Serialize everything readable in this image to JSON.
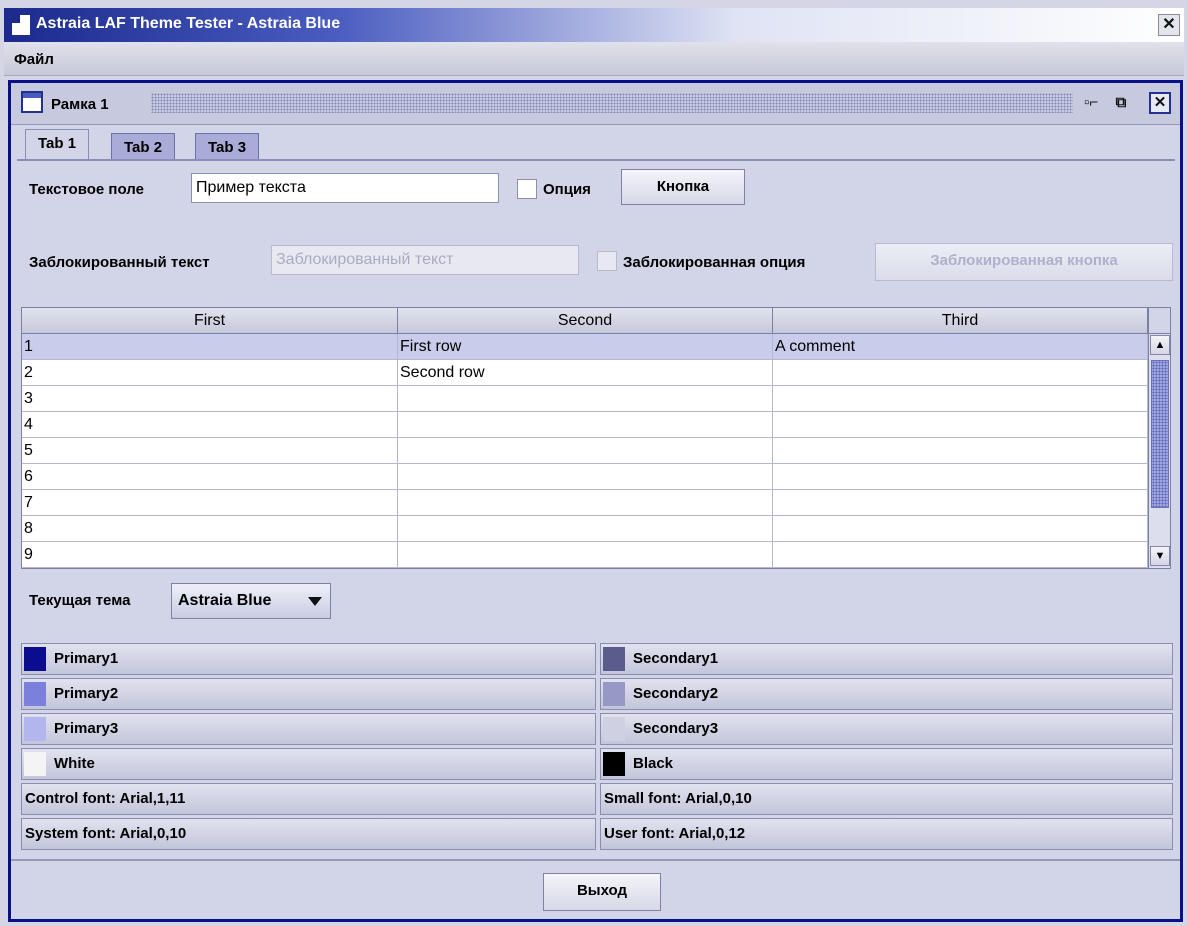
{
  "window": {
    "title": "Astraia LAF Theme Tester - Astraia Blue",
    "close_glyph": "✕"
  },
  "menu": {
    "file": "Файл"
  },
  "frame": {
    "title": "Рамка 1",
    "min_glyph": "▫⌐",
    "max_glyph": "⧉",
    "close_glyph": "✕"
  },
  "tabs": [
    {
      "label": "Tab 1"
    },
    {
      "label": "Tab 2"
    },
    {
      "label": "Tab 3"
    }
  ],
  "row1": {
    "text_label": "Текстовое поле",
    "text_value": "Пример текста",
    "check_label": "Опция",
    "button_label": "Кнопка"
  },
  "row2": {
    "text_label": "Заблокированный текст",
    "text_value": "Заблокированный текст",
    "check_label": "Заблокированная опция",
    "button_label": "Заблокированная кнопка"
  },
  "table": {
    "columns": [
      "First",
      "Second",
      "Third"
    ],
    "rows": [
      [
        "1",
        "First row",
        "A comment"
      ],
      [
        "2",
        "Second row",
        ""
      ],
      [
        "3",
        "",
        ""
      ],
      [
        "4",
        "",
        ""
      ],
      [
        "5",
        "",
        ""
      ],
      [
        "6",
        "",
        ""
      ],
      [
        "7",
        "",
        ""
      ],
      [
        "8",
        "",
        ""
      ],
      [
        "9",
        "",
        ""
      ]
    ]
  },
  "theme": {
    "label": "Текущая тема",
    "value": "Astraia Blue"
  },
  "colors": {
    "primary1": {
      "label": "Primary1",
      "hex": "#0b0c8e"
    },
    "primary2": {
      "label": "Primary2",
      "hex": "#7b80dc"
    },
    "primary3": {
      "label": "Primary3",
      "hex": "#b3b6ec"
    },
    "white": {
      "label": "White",
      "hex": "#f4f4f4"
    },
    "secondary1": {
      "label": "Secondary1",
      "hex": "#5a5c8c"
    },
    "secondary2": {
      "label": "Secondary2",
      "hex": "#9699c5"
    },
    "secondary3": {
      "label": "Secondary3",
      "hex": "#cfd1e3"
    },
    "black": {
      "label": "Black",
      "hex": "#000000"
    }
  },
  "fonts": {
    "control": "Control font: Arial,1,11",
    "small": "Small font: Arial,0,10",
    "system": "System font: Arial,0,10",
    "user": "User font: Arial,0,12"
  },
  "exit": {
    "label": "Выход"
  }
}
